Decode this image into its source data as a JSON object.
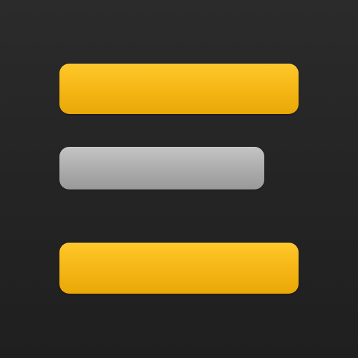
{
  "icon": {
    "name": "menu-icon",
    "background_color": "#252525",
    "bars": [
      {
        "name": "top-bar",
        "color": "#f4b515"
      },
      {
        "name": "middle-bar",
        "color": "#adadad"
      },
      {
        "name": "bottom-bar",
        "color": "#f4b515"
      }
    ]
  }
}
